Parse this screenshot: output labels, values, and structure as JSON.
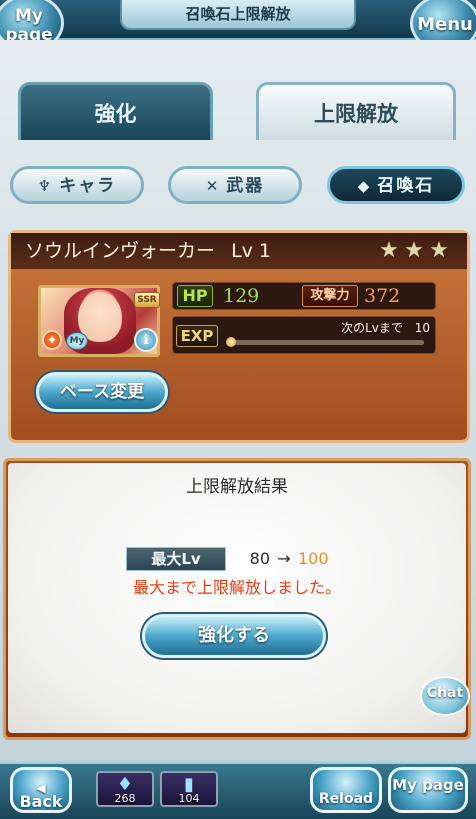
{
  "header": {
    "title": "召喚石上限解放",
    "mypage_label": "My page",
    "menu_label": "Menu"
  },
  "tabs": [
    {
      "label": "強化",
      "active": false
    },
    {
      "label": "上限解放",
      "active": true
    }
  ],
  "categories": [
    {
      "label": "キャラ",
      "icon": "character-icon",
      "active": false
    },
    {
      "label": "武器",
      "icon": "weapon-icon",
      "active": false
    },
    {
      "label": "召喚石",
      "icon": "summon-stone-icon",
      "active": true
    }
  ],
  "summon": {
    "name": "ソウルインヴォーカー",
    "level_text": "Lv 1",
    "stars_total": 3,
    "rarity": "SSR",
    "hp_label": "HP",
    "hp": "129",
    "atk_label": "攻撃力",
    "atk": "372",
    "exp_label": "EXP",
    "next_lv_text": "次のLvまで",
    "next_lv_value": "10",
    "exp_progress": 0.0,
    "my_badge": "My",
    "base_change_label": "ベース変更"
  },
  "result": {
    "title": "上限解放結果",
    "max_lv_label": "最大Lv",
    "from": "80",
    "arrow": "→",
    "to": "100",
    "message": "最大まで上限解放しました。",
    "enhance_button": "強化する"
  },
  "chat_label": "Chat",
  "footer": {
    "back_label": "Back",
    "reload_label": "Reload",
    "mypage_label": "My page",
    "items": [
      {
        "icon": "blue-crystal-icon",
        "count": "268"
      },
      {
        "icon": "blue-potion-icon",
        "count": "104"
      }
    ]
  },
  "colors": {
    "accent_blue": "#4ca7cc",
    "panel_brown": "#a34d1f",
    "hp_green": "#9ee04a",
    "atk_orange": "#ff9c4a",
    "result_to": "#ee8c20",
    "result_message": "#ee3d12"
  }
}
